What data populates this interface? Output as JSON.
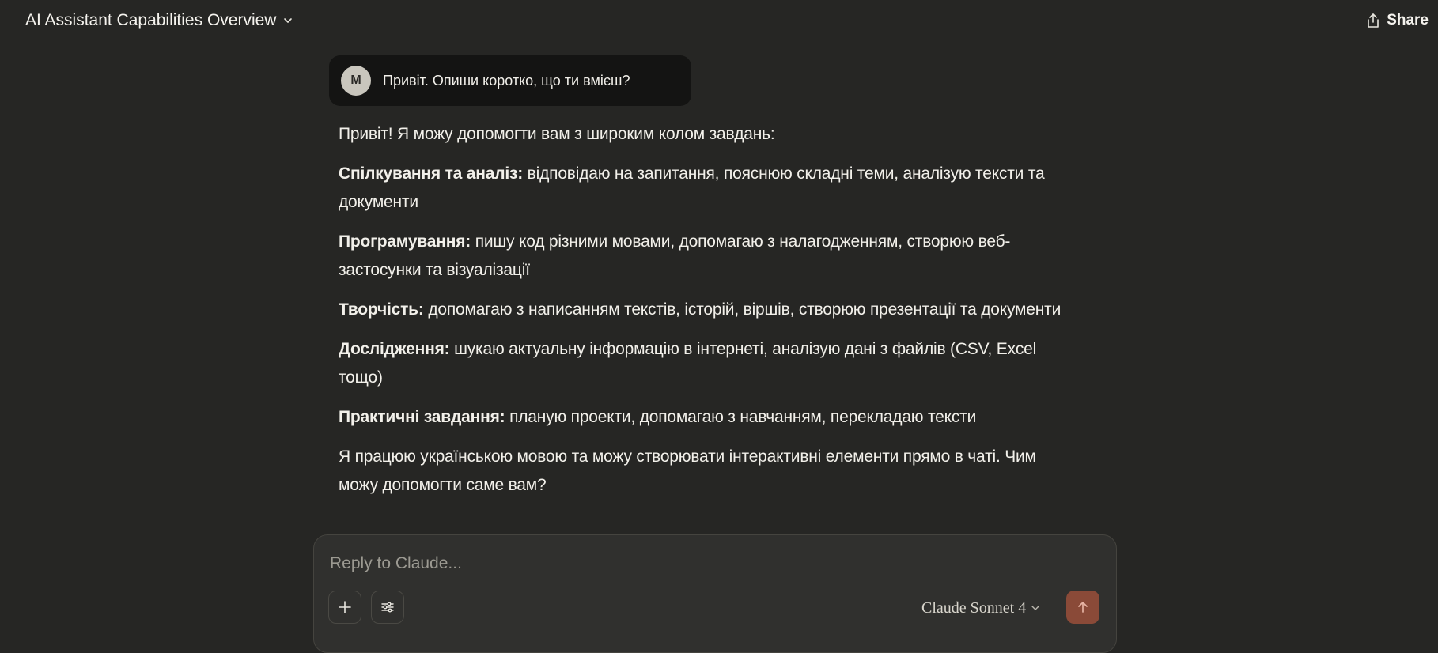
{
  "header": {
    "title": "AI Assistant Capabilities Overview",
    "share_label": "Share"
  },
  "conversation": {
    "user": {
      "avatar_initial": "M",
      "message": "Привіт. Опиши коротко, що ти вмієш?"
    },
    "assistant": {
      "intro": "Привіт! Я можу допомогти вам з широким колом завдань:",
      "sections": [
        {
          "label": "Спілкування та аналіз:",
          "text": " відповідаю на запитання, пояснюю складні теми, аналізую тексти та документи"
        },
        {
          "label": "Програмування:",
          "text": " пишу код різними мовами, допомагаю з налагодженням, створюю веб-застосунки та візуалізації"
        },
        {
          "label": "Творчість:",
          "text": " допомагаю з написанням текстів, історій, віршів, створюю презентації та документи"
        },
        {
          "label": "Дослідження:",
          "text": " шукаю актуальну інформацію в інтернеті, аналізую дані з файлів (CSV, Excel тощо)"
        },
        {
          "label": "Практичні завдання:",
          "text": " планую проекти, допомагаю з навчанням, перекладаю тексти"
        }
      ],
      "outro": "Я працюю українською мовою та можу створювати інтерактивні елементи прямо в чаті. Чим можу допомогти саме вам?"
    }
  },
  "composer": {
    "placeholder": "Reply to Claude...",
    "model_label": "Claude Sonnet 4"
  },
  "icons": {
    "title_chevron": "chevron-down-icon",
    "share": "share-icon",
    "add": "plus-icon",
    "tools": "sliders-icon",
    "model_chevron": "chevron-down-icon",
    "send": "arrow-up-icon"
  },
  "colors": {
    "background": "#262624",
    "user_bubble": "#141413",
    "composer": "#30302e",
    "send_button": "#8a4a38"
  }
}
